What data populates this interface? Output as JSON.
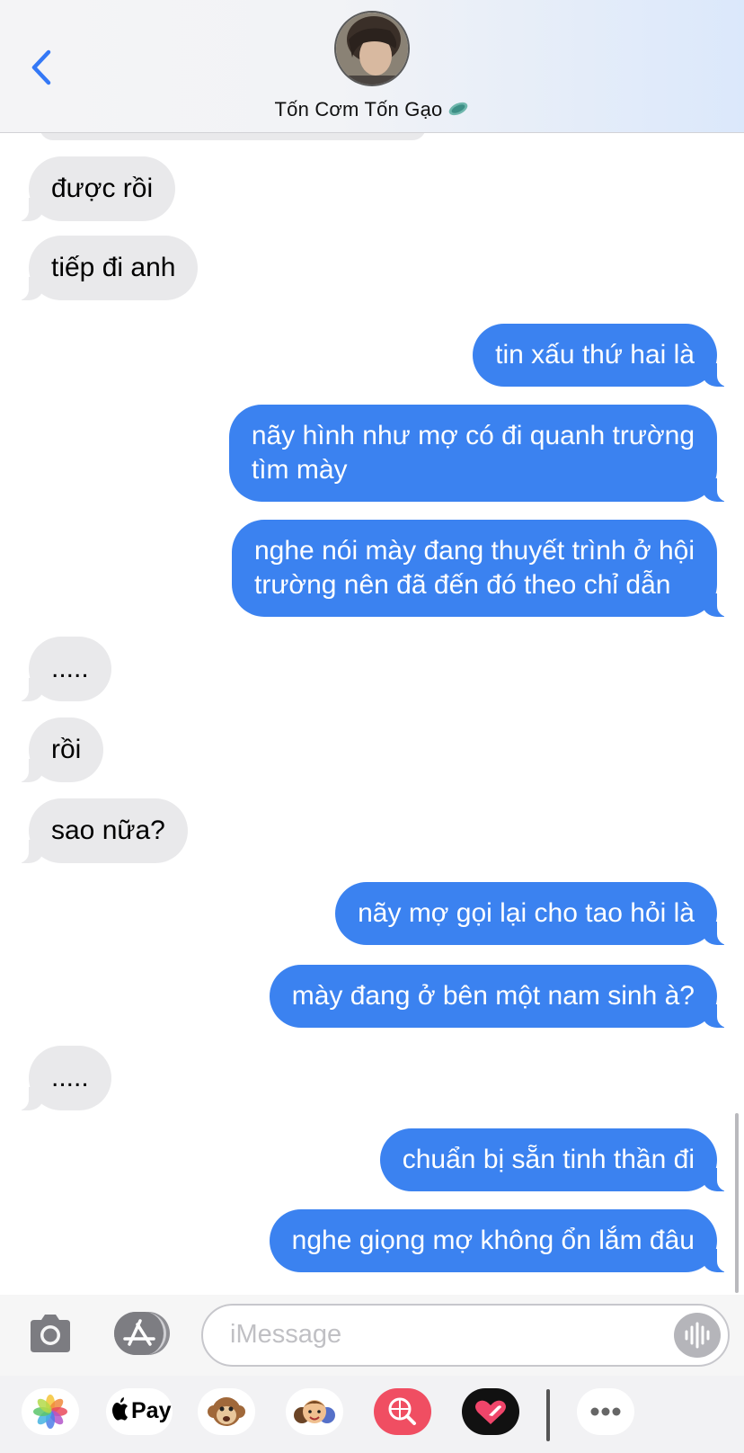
{
  "header": {
    "back_icon": "chevron-left-icon",
    "contact_name": "Tốn Cơm Tốn Gạo",
    "contact_emoji": "🩴"
  },
  "messages": [
    {
      "side": "in",
      "text": "được rồi"
    },
    {
      "side": "in",
      "text": "tiếp đi anh"
    },
    {
      "side": "out",
      "text": "tin xấu thứ hai là"
    },
    {
      "side": "out",
      "lines": [
        "nãy hình như mợ có đi quanh trường",
        "tìm mày"
      ]
    },
    {
      "side": "out",
      "lines": [
        "nghe nói mày đang thuyết trình ở hội",
        "trường nên đã đến đó theo chỉ dẫn"
      ]
    },
    {
      "side": "in",
      "text": "....."
    },
    {
      "side": "in",
      "text": "rồi"
    },
    {
      "side": "in",
      "text": "sao nữa?"
    },
    {
      "side": "out",
      "text": "nãy mợ gọi lại cho tao hỏi là"
    },
    {
      "side": "out",
      "text": "mày đang ở bên một nam sinh à?"
    },
    {
      "side": "in",
      "text": "....."
    },
    {
      "side": "out",
      "text": "chuẩn bị sẵn tinh thần đi"
    },
    {
      "side": "out",
      "text": "nghe giọng mợ không ổn lắm đâu"
    }
  ],
  "input": {
    "placeholder": "iMessage",
    "camera_icon": "camera-icon",
    "apps_icon": "app-store-icon",
    "audio_icon": "audio-waveform-icon"
  },
  "app_strip": {
    "apps": [
      "photos-icon",
      "apple-pay-icon",
      "monkey-memoji-icon",
      "memoji-stickers-icon",
      "image-search-icon",
      "digital-touch-icon",
      "more-icon"
    ],
    "apple_pay_label": "Pay"
  },
  "colors": {
    "outgoing_bubble": "#3b82f0",
    "incoming_bubble": "#e9e9eb",
    "accent": "#3478f6"
  }
}
